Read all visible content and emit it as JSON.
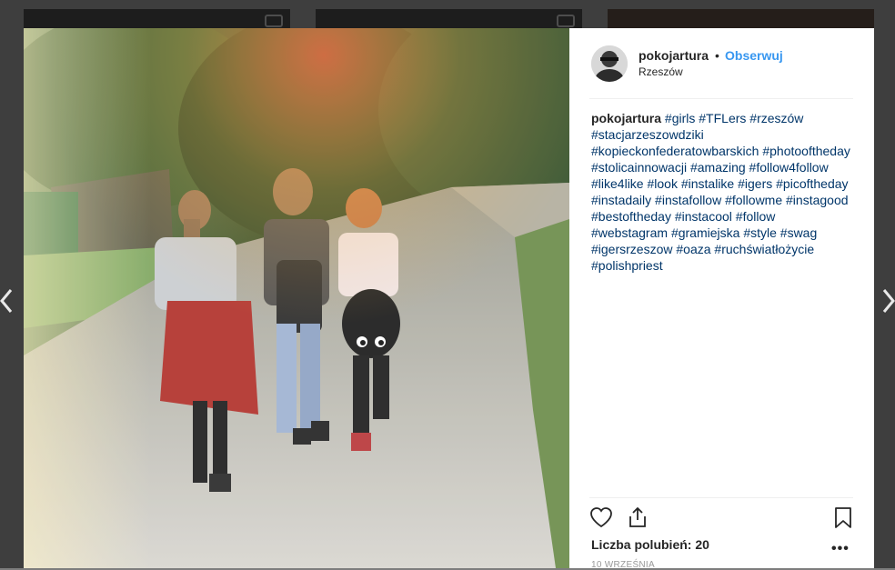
{
  "post": {
    "username": "pokojartura",
    "separator": "•",
    "follow_label": "Obserwuj",
    "location": "Rzeszów",
    "caption": {
      "author": "pokojartura",
      "hashtags": [
        "#girls",
        "#TFLers",
        "#rzeszów",
        "#stacjarzeszowdziki",
        "#kopieckonfederatowbarskich",
        "#photooftheday",
        "#stolicainnowacji",
        "#amazing",
        "#follow4follow",
        "#like4like",
        "#look",
        "#instalike",
        "#igers",
        "#picoftheday",
        "#instadaily",
        "#instafollow",
        "#followme",
        "#instagood",
        "#bestoftheday",
        "#instacool",
        "#follow",
        "#webstagram",
        "#gramiejska",
        "#style",
        "#swag",
        "#igersrzeszow",
        "#oaza",
        "#ruchświatłożycie",
        "#polishpriest"
      ]
    },
    "likes_text": "Liczba polubień: 20",
    "date": "10 WRZEŚNIA",
    "more_label": "•••"
  },
  "icons": {
    "like": "heart-outline-icon",
    "share": "share-upload-icon",
    "save": "bookmark-icon",
    "prev": "chevron-left-icon",
    "next": "chevron-right-icon"
  },
  "colors": {
    "link_blue": "#3897f0",
    "hashtag": "#003569",
    "text": "#262626"
  }
}
